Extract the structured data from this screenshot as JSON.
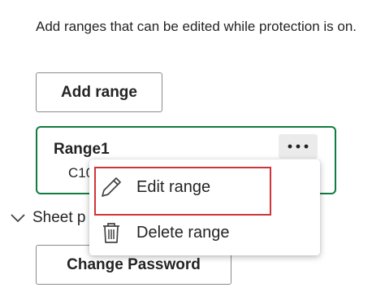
{
  "description": "Add ranges that can be edited while protection is on.",
  "add_range_label": "Add range",
  "range_card": {
    "name": "Range1",
    "address": "C10"
  },
  "context_menu": {
    "items": [
      {
        "label": "Edit range",
        "icon": "pencil-icon"
      },
      {
        "label": "Delete range",
        "icon": "trash-icon"
      }
    ]
  },
  "sheet_section": {
    "label": "Sheet p",
    "icon": "chevron-down-icon"
  },
  "change_password_label": "Change Password",
  "colors": {
    "card_border": "#107c41",
    "highlight": "#d13438"
  }
}
